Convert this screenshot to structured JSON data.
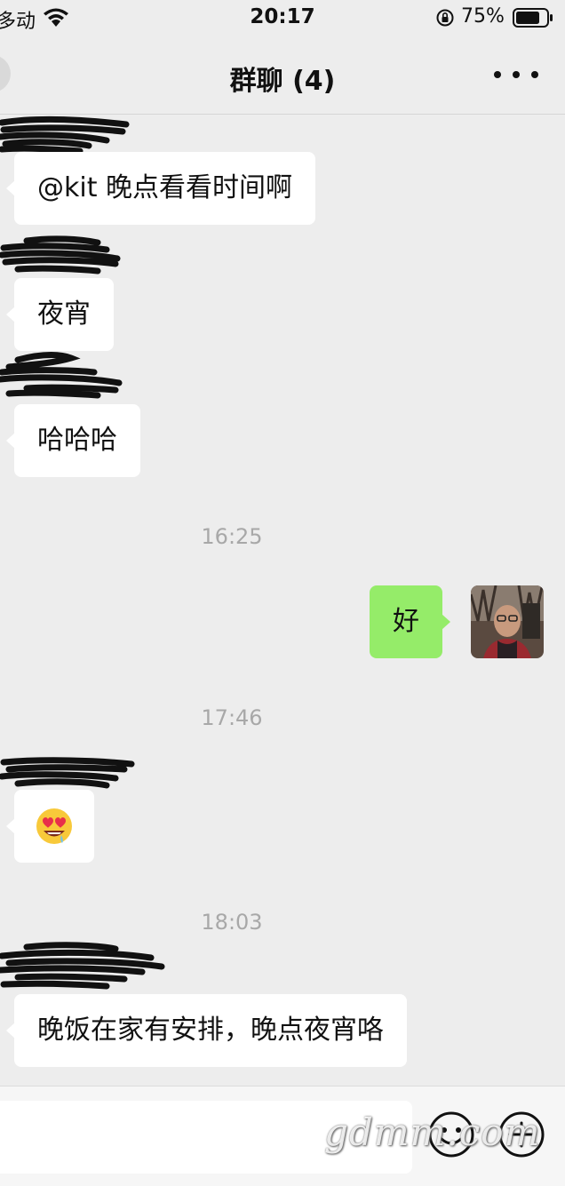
{
  "status_bar": {
    "carrier": "多动",
    "time": "20:17",
    "battery": "75%"
  },
  "nav": {
    "title": "群聊 (4)"
  },
  "messages": [
    {
      "from": "other",
      "text": "@kit 晚点看看时间啊"
    },
    {
      "from": "other",
      "text": "夜宵"
    },
    {
      "from": "other",
      "text": "哈哈哈"
    },
    {
      "type": "time",
      "text": "16:25"
    },
    {
      "from": "me",
      "text": "好"
    },
    {
      "type": "time",
      "text": "17:46"
    },
    {
      "from": "other",
      "emoji": "drooling-heart-eyes-face"
    },
    {
      "type": "time",
      "text": "18:03"
    },
    {
      "from": "other",
      "text": "晚饭在家有安排，晚点夜宵咯"
    }
  ],
  "colors": {
    "background": "#ededed",
    "my_bubble": "#95ec69",
    "other_bubble": "#ffffff",
    "timestamp": "#a8a8a8"
  },
  "input_bar": {
    "icons": [
      "emoji-icon",
      "plus-icon"
    ]
  },
  "watermark": "gdmm.com"
}
